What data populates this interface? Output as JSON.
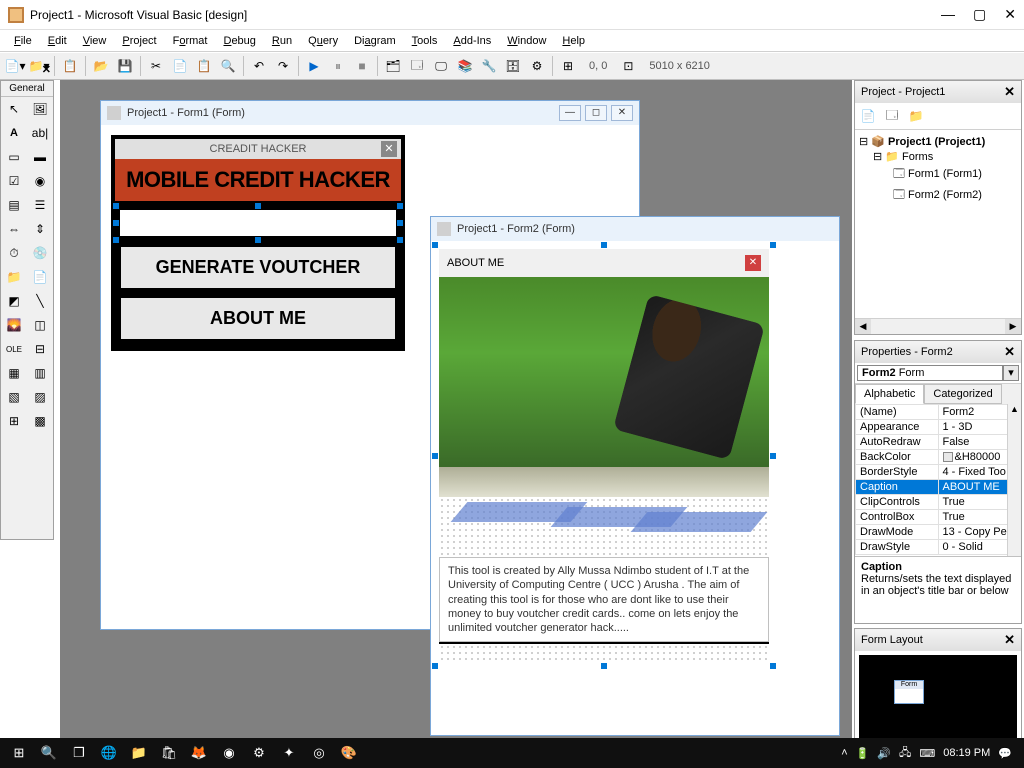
{
  "app": {
    "title": "Project1 - Microsoft Visual Basic [design]"
  },
  "menu": [
    "File",
    "Edit",
    "View",
    "Project",
    "Format",
    "Debug",
    "Run",
    "Query",
    "Diagram",
    "Tools",
    "Add-Ins",
    "Window",
    "Help"
  ],
  "menu_underline_idx": [
    0,
    0,
    0,
    0,
    1,
    0,
    0,
    3,
    4,
    0,
    0,
    0,
    0
  ],
  "toolbar": {
    "coords": "0, 0",
    "size": "5010 x 6210"
  },
  "toolbox": {
    "title": "General"
  },
  "form1": {
    "wintitle": "Project1 - Form1 (Form)",
    "caption": "CREADIT HACKER",
    "banner": "MOBILE CREDIT HACKER",
    "btn_generate": "GENERATE VOUTCHER",
    "btn_about": "ABOUT ME"
  },
  "form2": {
    "wintitle": "Project1 - Form2 (Form)",
    "caption": "ABOUT ME",
    "about_text": "This tool is created by Ally Mussa Ndimbo  student of I.T at the University of Computing Centre ( UCC ) Arusha .  The aim of creating this tool is for those who are dont like to use their money to buy voutcher credit cards.. come on lets enjoy the unlimited voutcher generator hack....."
  },
  "project_panel": {
    "title": "Project - Project1",
    "root": "Project1 (Project1)",
    "folder": "Forms",
    "items": [
      "Form1 (Form1)",
      "Form2 (Form2)"
    ]
  },
  "properties_panel": {
    "title": "Properties - Form2",
    "object": "Form2",
    "object_type": "Form",
    "tab_alpha": "Alphabetic",
    "tab_cat": "Categorized",
    "rows": [
      [
        "(Name)",
        "Form2"
      ],
      [
        "Appearance",
        "1 - 3D"
      ],
      [
        "AutoRedraw",
        "False"
      ],
      [
        "BackColor",
        "&H80000"
      ],
      [
        "BorderStyle",
        "4 - Fixed Too"
      ],
      [
        "Caption",
        "ABOUT ME"
      ],
      [
        "ClipControls",
        "True"
      ],
      [
        "ControlBox",
        "True"
      ],
      [
        "DrawMode",
        "13 - Copy Pe"
      ],
      [
        "DrawStyle",
        "0 - Solid"
      ]
    ],
    "selected_row": 5,
    "desc_title": "Caption",
    "desc_text": "Returns/sets the text displayed in an object's title bar or below"
  },
  "formlayout_panel": {
    "title": "Form Layout",
    "mini": "Form"
  },
  "taskbar": {
    "time": "08:19 PM"
  }
}
